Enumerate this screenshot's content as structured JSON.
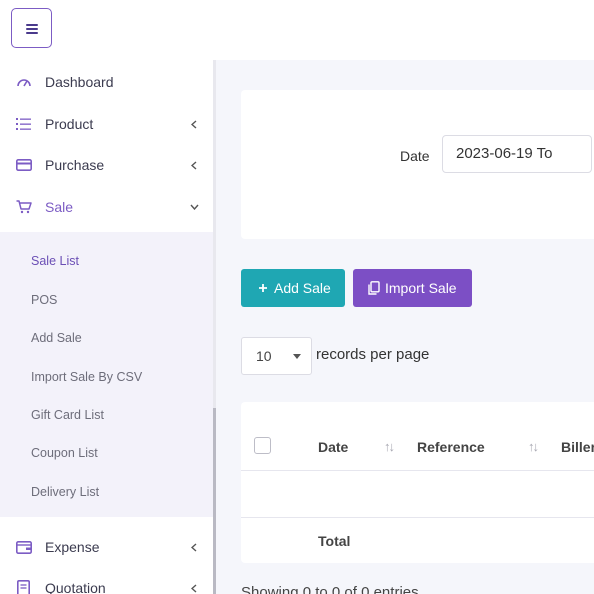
{
  "colors": {
    "accent": "#7c5cc4",
    "add_button": "#1fa7b3",
    "import_button": "#7c4fc5",
    "submenu_bg": "#f3f2fa"
  },
  "sidebar": {
    "items": [
      {
        "label": "Dashboard",
        "icon": "dashboard-gauge-icon",
        "has_chevron": false
      },
      {
        "label": "Product",
        "icon": "list-icon",
        "has_chevron": true
      },
      {
        "label": "Purchase",
        "icon": "card-icon",
        "has_chevron": true
      },
      {
        "label": "Sale",
        "icon": "cart-icon",
        "has_chevron": true,
        "expanded": true
      },
      {
        "label": "Expense",
        "icon": "wallet-icon",
        "has_chevron": true
      },
      {
        "label": "Quotation",
        "icon": "document-icon",
        "has_chevron": true
      }
    ],
    "sale_submenu": [
      "Sale List",
      "POS",
      "Add Sale",
      "Import Sale By CSV",
      "Gift Card List",
      "Coupon List",
      "Delivery List"
    ],
    "active_submenu": "Sale List"
  },
  "filter": {
    "date_label": "Date",
    "date_value": "2023-06-19 To"
  },
  "actions": {
    "add_sale": "Add Sale",
    "import_sale": "Import Sale"
  },
  "pagination": {
    "per_page": "10",
    "per_page_label": "records per page"
  },
  "table": {
    "columns": [
      "Date",
      "Reference",
      "Biller"
    ],
    "footer_total": "Total",
    "showing": "Showing 0 to 0 of 0 entries"
  }
}
